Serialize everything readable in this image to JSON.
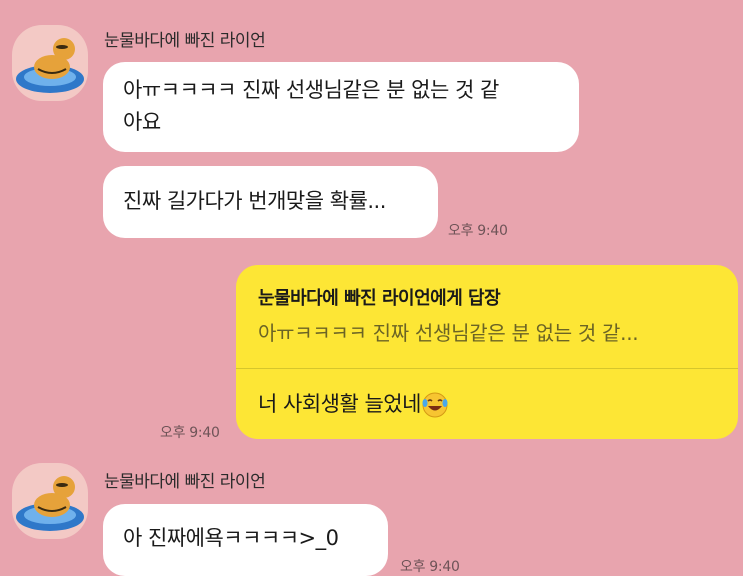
{
  "messages": {
    "sender1": {
      "name": "눈물바다에 빠진 라이언"
    },
    "msg1": {
      "line1": "아ㅠㅋㅋㅋㅋ 진짜 선생님같은 분 없는 것 같",
      "line2": "아요"
    },
    "msg2": {
      "text": "진짜 길가다가 번개맞을 확률..."
    },
    "time1": "오후 9:40",
    "reply": {
      "header": "눈물바다에 빠진 라이언에게 답장",
      "quote": "아ㅠㅋㅋㅋㅋ 진짜 선생님같은 분 없는 것 같...",
      "body": "너 사회생활 늘었네"
    },
    "time2": "오후 9:40",
    "sender2": {
      "name": "눈물바다에 빠진 라이언"
    },
    "msg3": {
      "text": "아 진짜에욕ㅋㅋㅋㅋ>_0"
    },
    "time3": "오후 9:40"
  },
  "icons": {
    "avatar": "lion-floating-avatar-icon",
    "emoji": "laughing-tears-emoji-icon"
  },
  "colors": {
    "background": "#e8a4ae",
    "my_bubble": "#fde635",
    "other_bubble": "#ffffff"
  }
}
